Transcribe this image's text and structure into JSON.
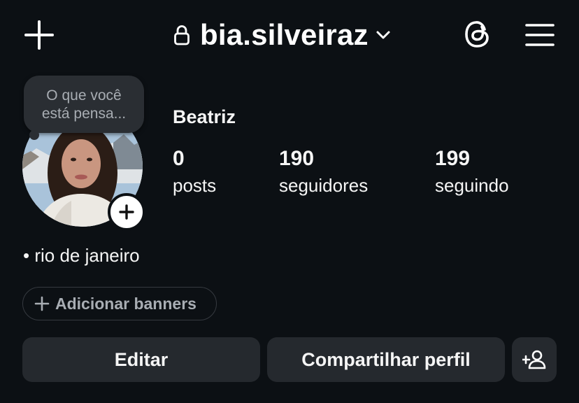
{
  "header": {
    "username": "bia.silveiraz",
    "icons": {
      "create": "plus-icon",
      "private": "lock-icon",
      "switch_account": "chevron-down-icon",
      "threads": "threads-icon",
      "menu": "hamburger-menu-icon"
    }
  },
  "note": {
    "placeholder": "O que você está pensa..."
  },
  "profile": {
    "display_name": "Beatriz",
    "avatar": "profile-photo",
    "stats": [
      {
        "value": "0",
        "label": "posts"
      },
      {
        "value": "190",
        "label": "seguidores"
      },
      {
        "value": "199",
        "label": "seguindo"
      }
    ],
    "bio": "• rio de janeiro"
  },
  "banners": {
    "add_label": "Adicionar banners"
  },
  "actions": {
    "edit_label": "Editar",
    "share_label": "Compartilhar perfil",
    "discover_icon": "add-person-icon"
  },
  "colors": {
    "background": "#0c1014",
    "button": "#25292e",
    "note_bubble": "#2a2e33",
    "muted_text": "#a8adb3",
    "text": "#f5f5f5"
  }
}
